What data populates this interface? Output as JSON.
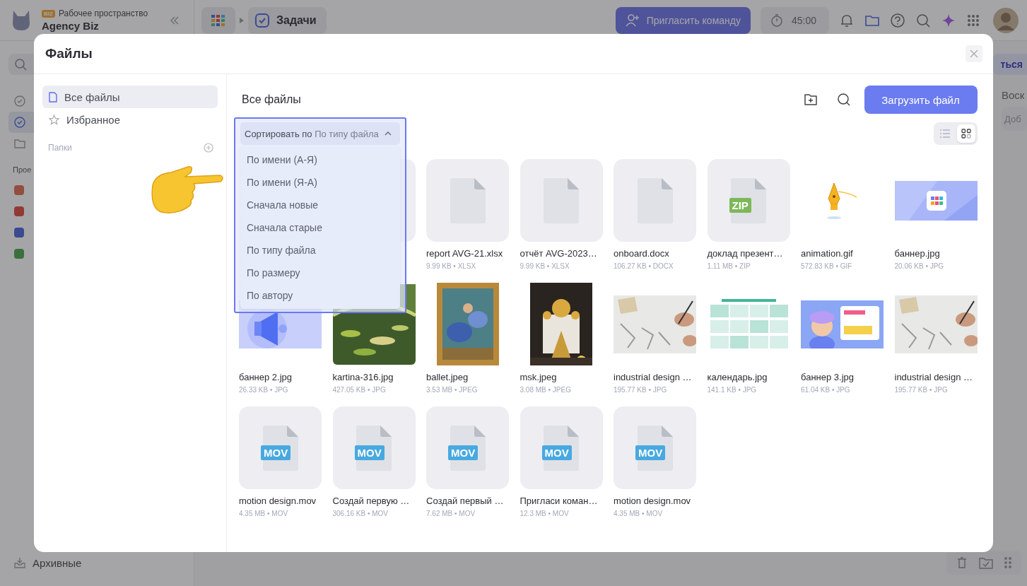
{
  "app": {
    "workspace_badge": "BIZ",
    "workspace_label": "Рабочее пространство",
    "workspace_name": "Agency Biz",
    "breadcrumb": "Задачи",
    "invite_button": "Пригласить команду",
    "timer": "45:00",
    "sidebar_items": [
      {
        "selected": false
      },
      {
        "selected": true
      },
      {
        "selected": false
      }
    ],
    "projects_heading": "Прое",
    "archive": "Архивные",
    "right_button": "ться",
    "right_heading": "Воск",
    "right_field": "Доб"
  },
  "modal": {
    "title": "Файлы",
    "nav": [
      {
        "label": "Все файлы",
        "selected": true
      },
      {
        "label": "Избранное",
        "selected": false
      }
    ],
    "folders_heading": "Папки",
    "heading": "Все файлы",
    "upload_button": "Загрузить файл",
    "views": [
      {
        "kind": "list",
        "selected": false
      },
      {
        "kind": "grid",
        "selected": true
      }
    ],
    "sort": {
      "label": "Сортировать по",
      "value": "По типу файла",
      "expanded": true,
      "options": [
        "По имени (А-Я)",
        "По имени (Я-А)",
        "Сначала новые",
        "Сначала старые",
        "По типу файла",
        "По размеру",
        "По автору"
      ]
    },
    "files": [
      {
        "kind": "hidden"
      },
      {
        "kind": "covered"
      },
      {
        "kind": "doc",
        "name": "report AVG-21.xlsx",
        "meta": "9.99 KB • XLSX"
      },
      {
        "kind": "doc",
        "name": "отчёт AVG-2023…",
        "meta": "9.99 KB • XLSX"
      },
      {
        "kind": "doc",
        "name": "onboard.docx",
        "meta": "106.27 KB • DOCX"
      },
      {
        "kind": "zip",
        "badge": "ZIP",
        "name": "доклад презент…",
        "meta": "1.11 MB • ZIP"
      },
      {
        "kind": "picture",
        "name": "animation.gif",
        "meta": "572.83 KB • GIF"
      },
      {
        "kind": "picture",
        "name": "баннер.jpg",
        "meta": "20.06 KB • JPG"
      },
      {
        "kind": "picture",
        "name": "баннер 2.jpg",
        "meta": "26.33 KB • JPG"
      },
      {
        "kind": "picture",
        "name": "kartina-316.jpg",
        "meta": "427.05 KB • JPG"
      },
      {
        "kind": "picture",
        "name": "ballet.jpeg",
        "meta": "3.53 MB • JPEG"
      },
      {
        "kind": "picture",
        "name": "msk.jpeg",
        "meta": "3.08 MB • JPEG"
      },
      {
        "kind": "picture",
        "name": "industrial design …",
        "meta": "195.77 KB • JPG"
      },
      {
        "kind": "picture",
        "name": "календарь.jpg",
        "meta": "141.1 KB • JPG"
      },
      {
        "kind": "picture",
        "name": "баннер 3.jpg",
        "meta": "61.04 KB • JPG"
      },
      {
        "kind": "picture",
        "name": "industrial design …",
        "meta": "195.77 KB • JPG"
      },
      {
        "kind": "mov",
        "badge": "MOV",
        "name": "motion design.mov",
        "meta": "4.35 MB • MOV"
      },
      {
        "kind": "mov",
        "badge": "MOV",
        "name": "Создай первую …",
        "meta": "306.16 KB • MOV"
      },
      {
        "kind": "mov",
        "badge": "MOV",
        "name": "Создай первый …",
        "meta": "7.62 MB • MOV"
      },
      {
        "kind": "mov",
        "badge": "MOV",
        "name": "Пригласи коман…",
        "meta": "12.3 MB • MOV"
      },
      {
        "kind": "mov",
        "badge": "MOV",
        "name": "motion design.mov",
        "meta": "4.35 MB • MOV"
      }
    ]
  }
}
